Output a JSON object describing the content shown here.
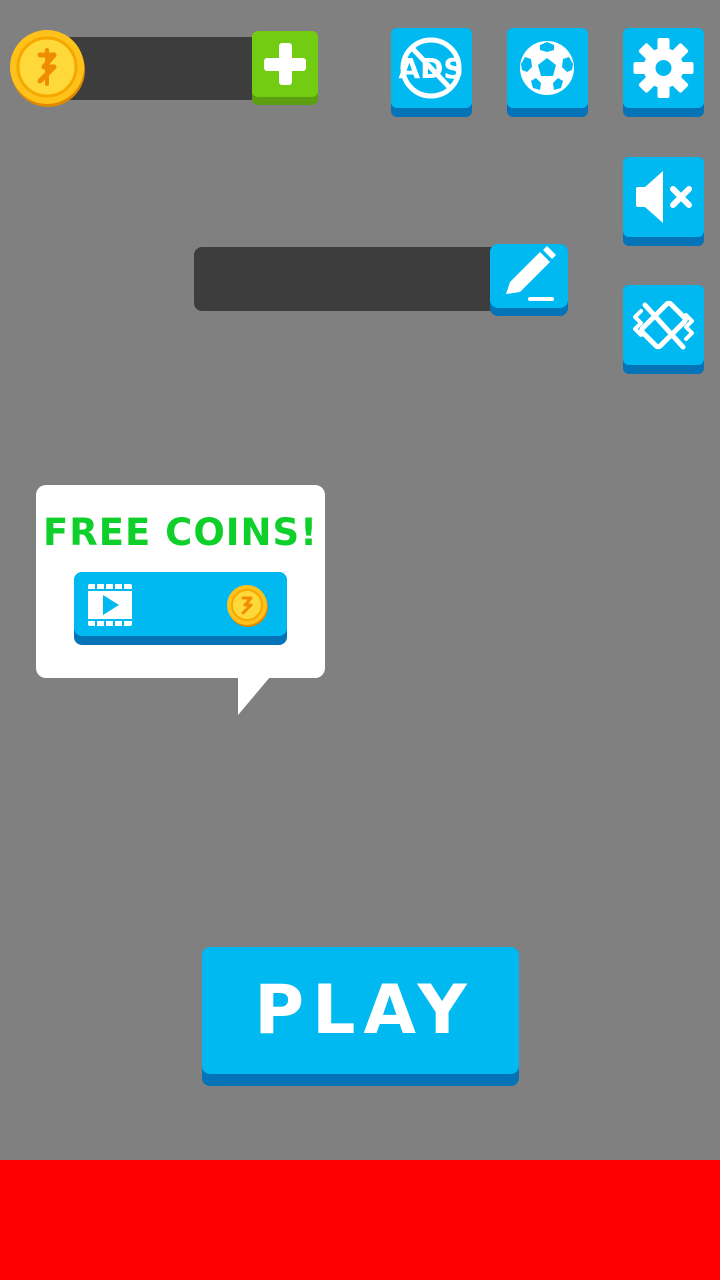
{
  "coins": {
    "count": "",
    "coin_icon": "coin-icon",
    "add_icon": "plus-icon",
    "colors": {
      "bar": "#3d3d3d",
      "add": "#72cc12"
    }
  },
  "top_buttons": [
    {
      "name": "no-ads-button",
      "icon": "no-ads-icon",
      "label": "ADS"
    },
    {
      "name": "ball-select-button",
      "icon": "soccer-ball-icon"
    },
    {
      "name": "settings-button",
      "icon": "gear-icon"
    }
  ],
  "side_buttons": [
    {
      "name": "sound-toggle-button",
      "icon": "sound-muted-icon"
    },
    {
      "name": "vibration-toggle-button",
      "icon": "vibration-off-icon"
    }
  ],
  "player": {
    "name": "",
    "edit_icon": "pencil-icon"
  },
  "free_coins": {
    "title": "FREE COINS!",
    "video_icon": "video-play-icon",
    "coin_icon": "coin-icon"
  },
  "play": {
    "label": "PLAY"
  },
  "colors": {
    "background": "#808080",
    "accent": "#00b9f1",
    "accent_shadow": "#0573b8",
    "free_coins_text": "#0fcf2a",
    "ad_banner": "#ff0000"
  }
}
